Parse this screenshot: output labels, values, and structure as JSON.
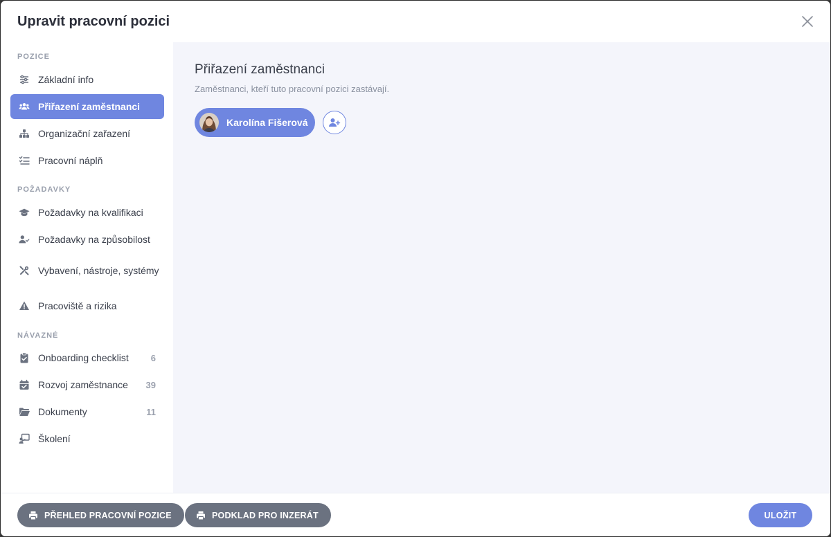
{
  "dialog": {
    "title": "Upravit pracovní pozici"
  },
  "sidebar": {
    "sections": [
      {
        "title": "POZICE"
      },
      {
        "title": "POŽADAVKY"
      },
      {
        "title": "NÁVAZNÉ"
      }
    ],
    "items": [
      {
        "label": "Základní info",
        "icon": "sliders-icon"
      },
      {
        "label": "Přiřazení zaměstnanci",
        "icon": "users-icon",
        "active": true
      },
      {
        "label": "Organizační zařazení",
        "icon": "org-chart-icon"
      },
      {
        "label": "Pracovní náplň",
        "icon": "checklist-icon"
      },
      {
        "label": "Požadavky na kvalifikaci",
        "icon": "graduation-cap-icon"
      },
      {
        "label": "Požadavky na způsobilost",
        "icon": "user-check-icon"
      },
      {
        "label": "Vybavení, nástroje, systémy",
        "icon": "tools-icon"
      },
      {
        "label": "Pracoviště a rizika",
        "icon": "warning-icon"
      },
      {
        "label": "Onboarding checklist",
        "icon": "clipboard-check-icon",
        "count": "6"
      },
      {
        "label": "Rozvoj zaměstnance",
        "icon": "calendar-check-icon",
        "count": "39"
      },
      {
        "label": "Dokumenty",
        "icon": "folder-icon",
        "count": "11"
      },
      {
        "label": "Školení",
        "icon": "training-icon"
      }
    ]
  },
  "main": {
    "title": "Přiřazení zaměstnanci",
    "subtitle": "Zaměstnanci, kteří tuto pracovní pozici zastávají.",
    "employees": [
      {
        "name": "Karolína Fišerová"
      }
    ]
  },
  "footer": {
    "overview_label": "PŘEHLED PRACOVNÍ POZICE",
    "ad_label": "PODKLAD PRO INZERÁT",
    "save_label": "ULOŽIT"
  },
  "colors": {
    "accent": "#6f86e0",
    "secondary_button": "#6b7280",
    "main_bg": "#f4f5fb"
  }
}
